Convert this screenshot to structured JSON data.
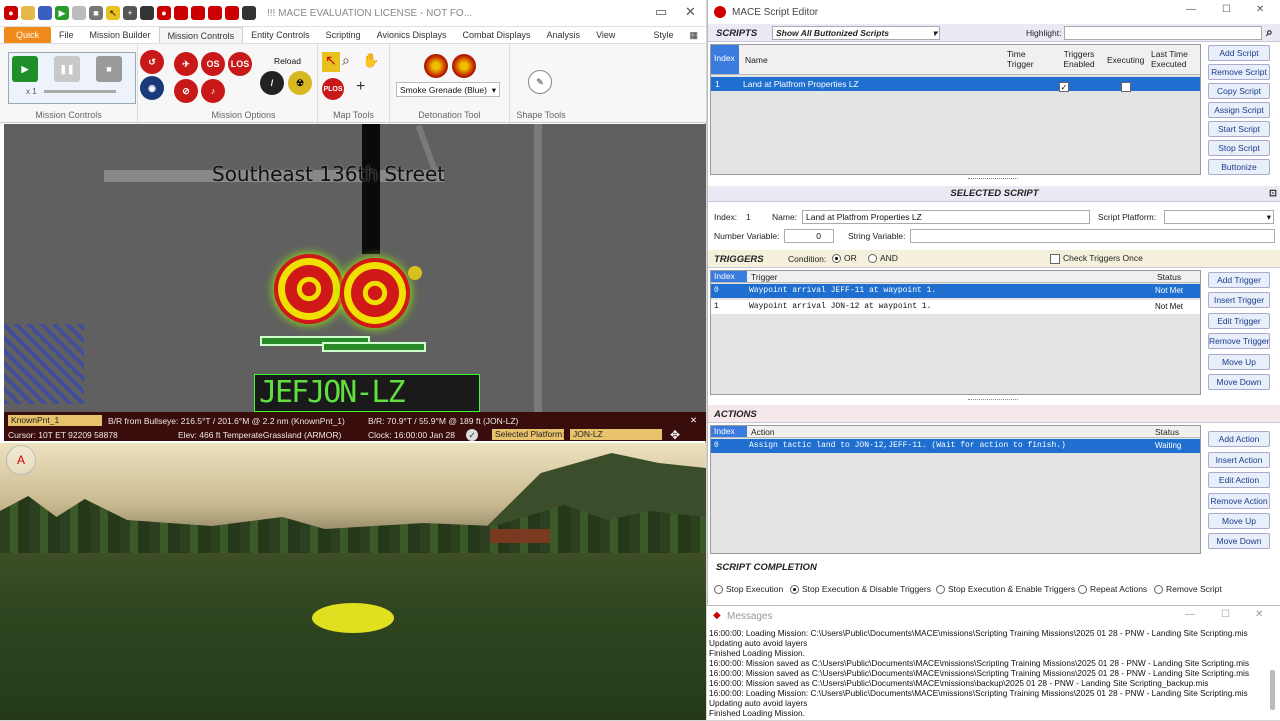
{
  "mace": {
    "title": "!!! MACE EVALUATION LICENSE - NOT FO...",
    "tabs": [
      "Quick",
      "File",
      "Mission Builder",
      "Mission Controls",
      "Entity Controls",
      "Scripting",
      "Avionics Displays",
      "Combat Displays",
      "Analysis",
      "View"
    ],
    "style_label": "Style",
    "groups": {
      "mission_controls": "Mission Controls",
      "mission_options": "Mission Options",
      "map_tools": "Map Tools",
      "detonation_tool": "Detonation Tool",
      "shape_tools": "Shape Tools"
    },
    "speed_label": "x 1",
    "reload_label": "Reload",
    "detonation_select": "Smoke Grenade (Blue)",
    "map": {
      "street_label": "Southeast 136th Street",
      "lz_label": "JEFJON-LZ"
    },
    "status": {
      "known_point": "KnownPnt_1",
      "br_bullseye": "B/R from Bullseye: 216.5°T / 201.6°M @ 2.2 nm (KnownPnt_1)",
      "br_lz": "B/R: 70.9°T / 55.9°M @ 189 ft (JON-LZ)",
      "cursor": "Cursor: 10T ET 92209 58878",
      "elev": "Elev: 466 ft TemperateGrassland (ARMOR)",
      "clock": "Clock: 16:00:00  Jan 28",
      "selected_platform_label": "Selected Platform:",
      "selected_platform_value": "JON-LZ"
    },
    "compass_label": "A"
  },
  "script_editor": {
    "title": "MACE Script Editor",
    "scripts_section": "SCRIPTS",
    "filter": "Show All Buttonized Scripts",
    "highlight_label": "Highlight:",
    "highlight_value": "",
    "columns": [
      "Index",
      "Name",
      "Time Trigger",
      "Triggers Enabled",
      "Executing",
      "Last Time Executed"
    ],
    "rows": [
      {
        "index": "1",
        "name": "Land at Platfrom Properties LZ",
        "time_trigger": "",
        "last": ""
      }
    ],
    "script_buttons": [
      "Add Script",
      "Remove Script",
      "Copy Script",
      "Assign Script",
      "Start Script",
      "Stop Script",
      "Buttonize"
    ],
    "selected_section": "SELECTED SCRIPT",
    "index_label": "Index:",
    "index_value": "1",
    "name_label": "Name:",
    "name_value": "Land at Platfrom Properties LZ",
    "platform_label": "Script Platform:",
    "number_var_label": "Number Variable:",
    "number_var_value": "0",
    "string_var_label": "String Variable:",
    "string_var_value": "",
    "triggers_section": "TRIGGERS",
    "condition_label": "Condition:",
    "condition_or": "OR",
    "condition_and": "AND",
    "check_once_label": "Check Triggers Once",
    "trigger_columns": [
      "Index",
      "Trigger",
      "Status"
    ],
    "triggers": [
      {
        "index": "0",
        "trigger": "Waypoint arrival JEFF-11 at waypoint 1.",
        "status": "Not Met"
      },
      {
        "index": "1",
        "trigger": "Waypoint arrival JON-12 at waypoint 1.",
        "status": "Not Met"
      }
    ],
    "trigger_buttons": [
      "Add Trigger",
      "Insert Trigger",
      "Edit Trigger",
      "Remove Trigger",
      "Move Up",
      "Move Down"
    ],
    "actions_section": "ACTIONS",
    "action_columns": [
      "Index",
      "Action",
      "Status"
    ],
    "actions": [
      {
        "index": "0",
        "action": "Assign tactic land to JON-12,JEFF-11. (Wait for action to finish.)",
        "status": "Waiting"
      }
    ],
    "action_buttons": [
      "Add Action",
      "Insert Action",
      "Edit Action",
      "Remove Action",
      "Move Up",
      "Move Down"
    ],
    "completion_section": "SCRIPT COMPLETION",
    "completion_options": [
      "Stop Execution",
      "Stop Execution & Disable Triggers",
      "Stop Execution & Enable Triggers",
      "Repeat Actions",
      "Remove Script"
    ],
    "completion_selected": 1
  },
  "messages": {
    "title": "Messages",
    "lines": [
      "16:00:00: Loading Mission: C:\\Users\\Public\\Documents\\MACE\\missions\\Scripting Training Missions\\2025 01 28  - PNW - Landing Site Scripting.mis",
      "           Updating auto avoid layers",
      "           Finished Loading Mission.",
      "16:00:00: Mission saved as C:\\Users\\Public\\Documents\\MACE\\missions\\Scripting Training Missions\\2025 01 28  - PNW - Landing Site Scripting.mis",
      "16:00:00: Mission saved as C:\\Users\\Public\\Documents\\MACE\\missions\\Scripting Training Missions\\2025 01 28  - PNW - Landing Site Scripting.mis",
      "16:00:00: Mission saved as C:\\Users\\Public\\Documents\\MACE\\missions\\backup\\2025 01 28  - PNW - Landing Site Scripting_backup.mis",
      "16:00:00: Loading Mission: C:\\Users\\Public\\Documents\\MACE\\missions\\Scripting Training Missions\\2025 01 28  - PNW - Landing Site Scripting.mis",
      "           Updating auto avoid layers",
      "           Finished Loading Mission."
    ]
  },
  "colors": {
    "accent": "#f08a1a",
    "selection": "#1e6fd0",
    "status_bar": "#3a0d0d",
    "target_red": "#d01818",
    "target_yellow": "#e8e000"
  }
}
